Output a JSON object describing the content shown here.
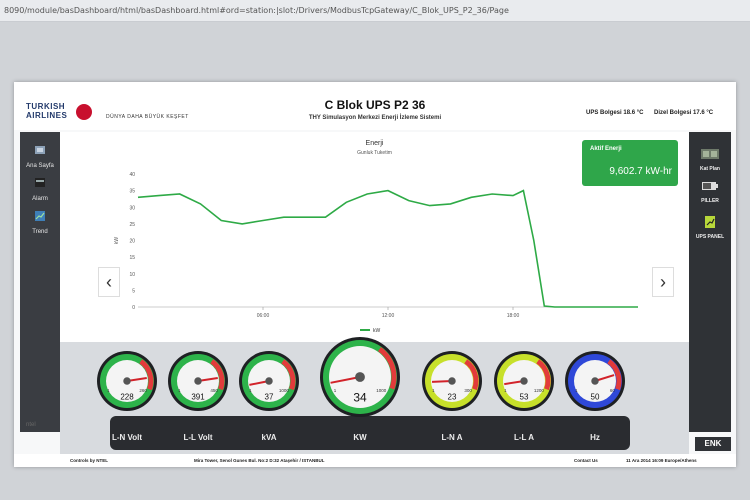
{
  "browser": {
    "url": "8090/module/basDashboard/html/basDashboard.html#ord=station:|slot:/Drivers/ModbusTcpGateway/C_Blok_UPS_P2_36/Page"
  },
  "header": {
    "logo_line1": "TURKISH",
    "logo_line2": "AIRLINES",
    "tagline": "DÜNYA DAHA BÜYÜK  KEŞFET",
    "title": "C Blok UPS P2 36",
    "subtitle": "THY Simulasyon Merkezi Enerji İzleme Sistemi",
    "ups_temp_label": "UPS Bolgesi",
    "ups_temp_value": "18.6 °C",
    "diesel_temp_label": "Dizel Bolgesi",
    "diesel_temp_value": "17.6 °C"
  },
  "sidebar": {
    "items": [
      {
        "label": "Ana Sayfa",
        "icon": "home-icon"
      },
      {
        "label": "Alarm",
        "icon": "alarm-icon"
      },
      {
        "label": "Trend",
        "icon": "trend-icon"
      }
    ]
  },
  "rightbar": {
    "items": [
      {
        "label": "Kat Plan",
        "icon": "floor-plan-icon"
      },
      {
        "label": "PILLER",
        "icon": "battery-icon"
      },
      {
        "label": "UPS PANEL",
        "icon": "ups-panel-icon"
      }
    ],
    "brand": "ENK"
  },
  "energy_card": {
    "label": "Aktif Enerji",
    "value": "9,602.7 kW-hr"
  },
  "chart_data": {
    "type": "line",
    "title": "Enerji",
    "subtitle": "Gunluk Tuketim",
    "ylabel": "kW",
    "yticks": [
      0,
      5,
      10,
      15,
      20,
      25,
      30,
      35,
      40
    ],
    "ylim": [
      0,
      40
    ],
    "xticks": [
      "06:00",
      "12:00",
      "18:00"
    ],
    "xlim": [
      0,
      24
    ],
    "x_tick_values": [
      6,
      12,
      18
    ],
    "legend": "kW",
    "legend_position": "bottom-center",
    "series": [
      {
        "name": "kW",
        "color": "#2eaa46",
        "x": [
          0,
          1,
          2,
          3,
          4,
          5,
          6,
          7,
          8,
          9,
          10,
          11,
          12,
          13,
          14,
          15,
          16,
          17,
          18,
          18.5,
          19,
          19.5,
          20,
          21,
          22,
          23,
          24
        ],
        "y": [
          33,
          33.5,
          34,
          31,
          26,
          25,
          26,
          27,
          27,
          27,
          31.5,
          34,
          35,
          32,
          30.5,
          31,
          33,
          34,
          33.5,
          35,
          20,
          0.3,
          0,
          0,
          0,
          0,
          0
        ]
      }
    ]
  },
  "gauges": [
    {
      "label": "L-N Volt",
      "value": "228",
      "min": "1",
      "max": "260",
      "level": 0.87,
      "face": "#2db34a"
    },
    {
      "label": "L-L Volt",
      "value": "391",
      "min": "1",
      "max": "450",
      "level": 0.87,
      "face": "#2db34a"
    },
    {
      "label": "kVA",
      "value": "37",
      "min": "1",
      "max": "1000",
      "level": 0.04,
      "face": "#2db34a"
    },
    {
      "label": "KW",
      "value": "34",
      "min": "1",
      "max": "1000",
      "level": 0.04,
      "face": "#2db34a"
    },
    {
      "label": "L-N A",
      "value": "23",
      "min": "1",
      "max": "300",
      "level": 0.08,
      "face": "#c7e02a"
    },
    {
      "label": "L-L A",
      "value": "53",
      "min": "1",
      "max": "1200",
      "level": 0.05,
      "face": "#c7e02a"
    },
    {
      "label": "Hz",
      "value": "50",
      "min": "1",
      "max": "60",
      "level": 0.83,
      "face": "#2f48d8"
    }
  ],
  "footer": {
    "controls": "Controls by NTEL",
    "address": "Mira Tower, Senol Gunes Bul. No:2 D:32 Ataşehir / ISTANBUL",
    "contact": "Contact Us",
    "datetime": "11 Ara 2014 16:09 Europe/Athens"
  },
  "colors": {
    "accent_green": "#2fa64a",
    "sidebar": "#3a3d42",
    "redzone": "#e23b3b"
  }
}
